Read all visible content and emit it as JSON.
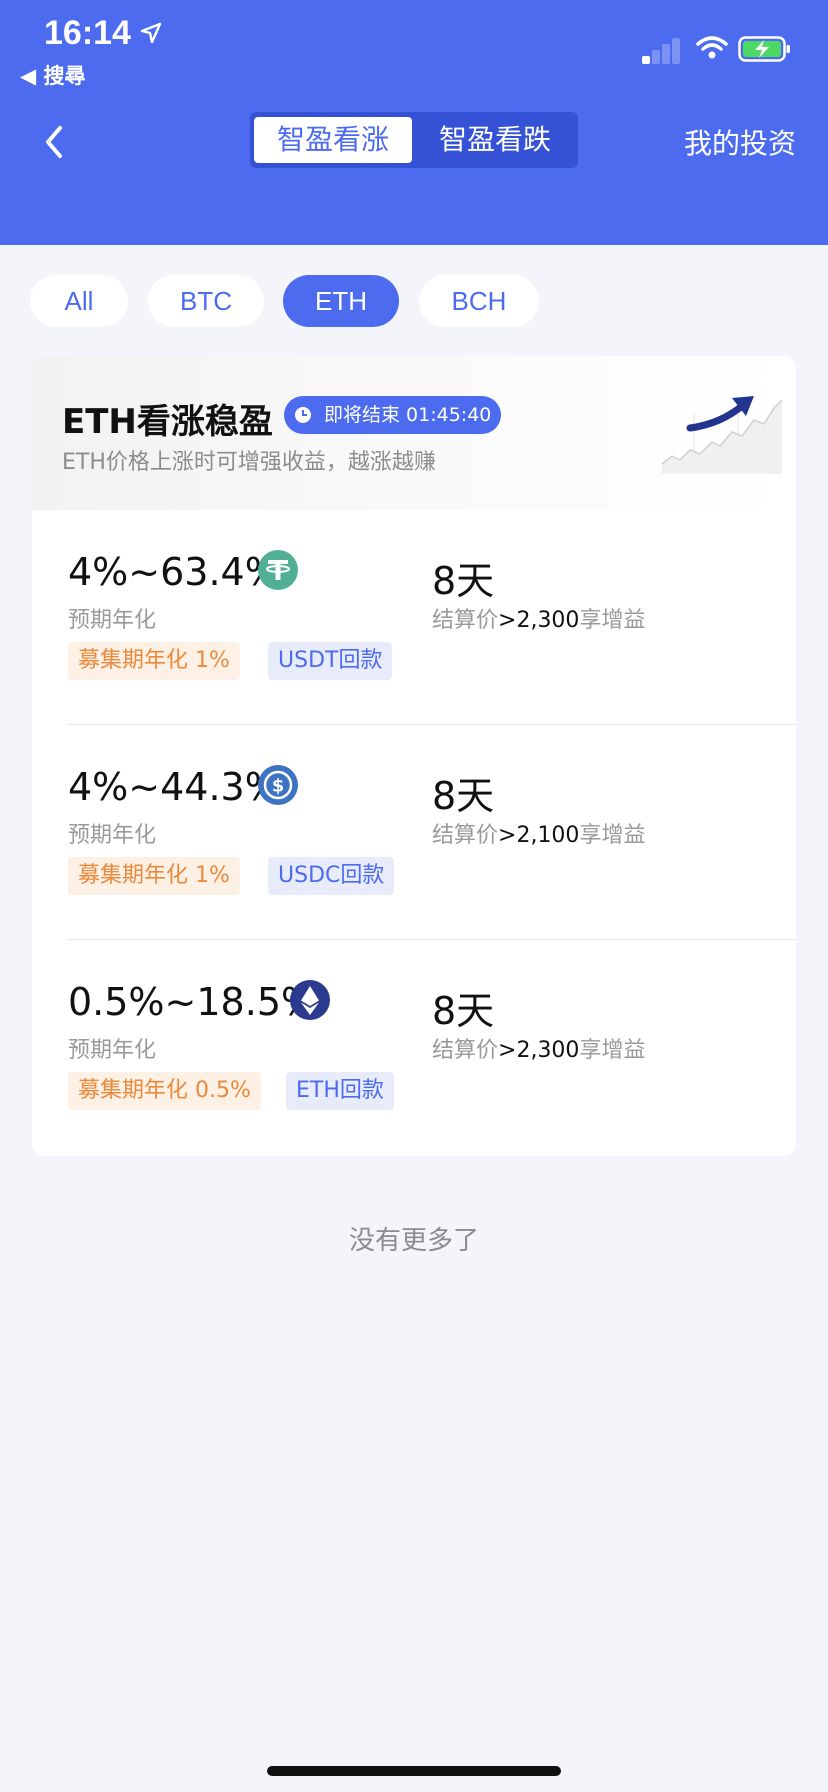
{
  "status": {
    "time": "16:14",
    "back_label": "◀ 搜尋"
  },
  "header": {
    "tabs": [
      {
        "label": "智盈看涨",
        "active": true
      },
      {
        "label": "智盈看跌",
        "active": false
      }
    ],
    "right_link": "我的投资",
    "accent": "#4c6bef"
  },
  "filters": [
    {
      "label": "All",
      "active": false
    },
    {
      "label": "BTC",
      "active": false
    },
    {
      "label": "ETH",
      "active": true
    },
    {
      "label": "BCH",
      "active": false
    }
  ],
  "card": {
    "title": "ETH看涨稳盈",
    "timer": "即将结束 01:45:40",
    "subtitle": "ETH价格上涨时可增强收益，越涨越赚",
    "products": [
      {
        "rate": "4%~63.4%",
        "coin_icon": "usdt-icon",
        "rate_label": "预期年化",
        "tag_raise": "募集期年化 1%",
        "tag_payback": "USDT回款",
        "days": "8天",
        "settle_prefix": "结算价",
        "settle_value": ">2,300",
        "settle_suffix": "享增益"
      },
      {
        "rate": "4%~44.3%",
        "coin_icon": "usdc-icon",
        "rate_label": "预期年化",
        "tag_raise": "募集期年化 1%",
        "tag_payback": "USDC回款",
        "days": "8天",
        "settle_prefix": "结算价",
        "settle_value": ">2,100",
        "settle_suffix": "享增益"
      },
      {
        "rate": "0.5%~18.5%",
        "coin_icon": "eth-icon",
        "rate_label": "预期年化",
        "tag_raise": "募集期年化 0.5%",
        "tag_payback": "ETH回款",
        "days": "8天",
        "settle_prefix": "结算价",
        "settle_value": ">2,300",
        "settle_suffix": "享增益"
      }
    ]
  },
  "footer": {
    "no_more": "没有更多了"
  }
}
